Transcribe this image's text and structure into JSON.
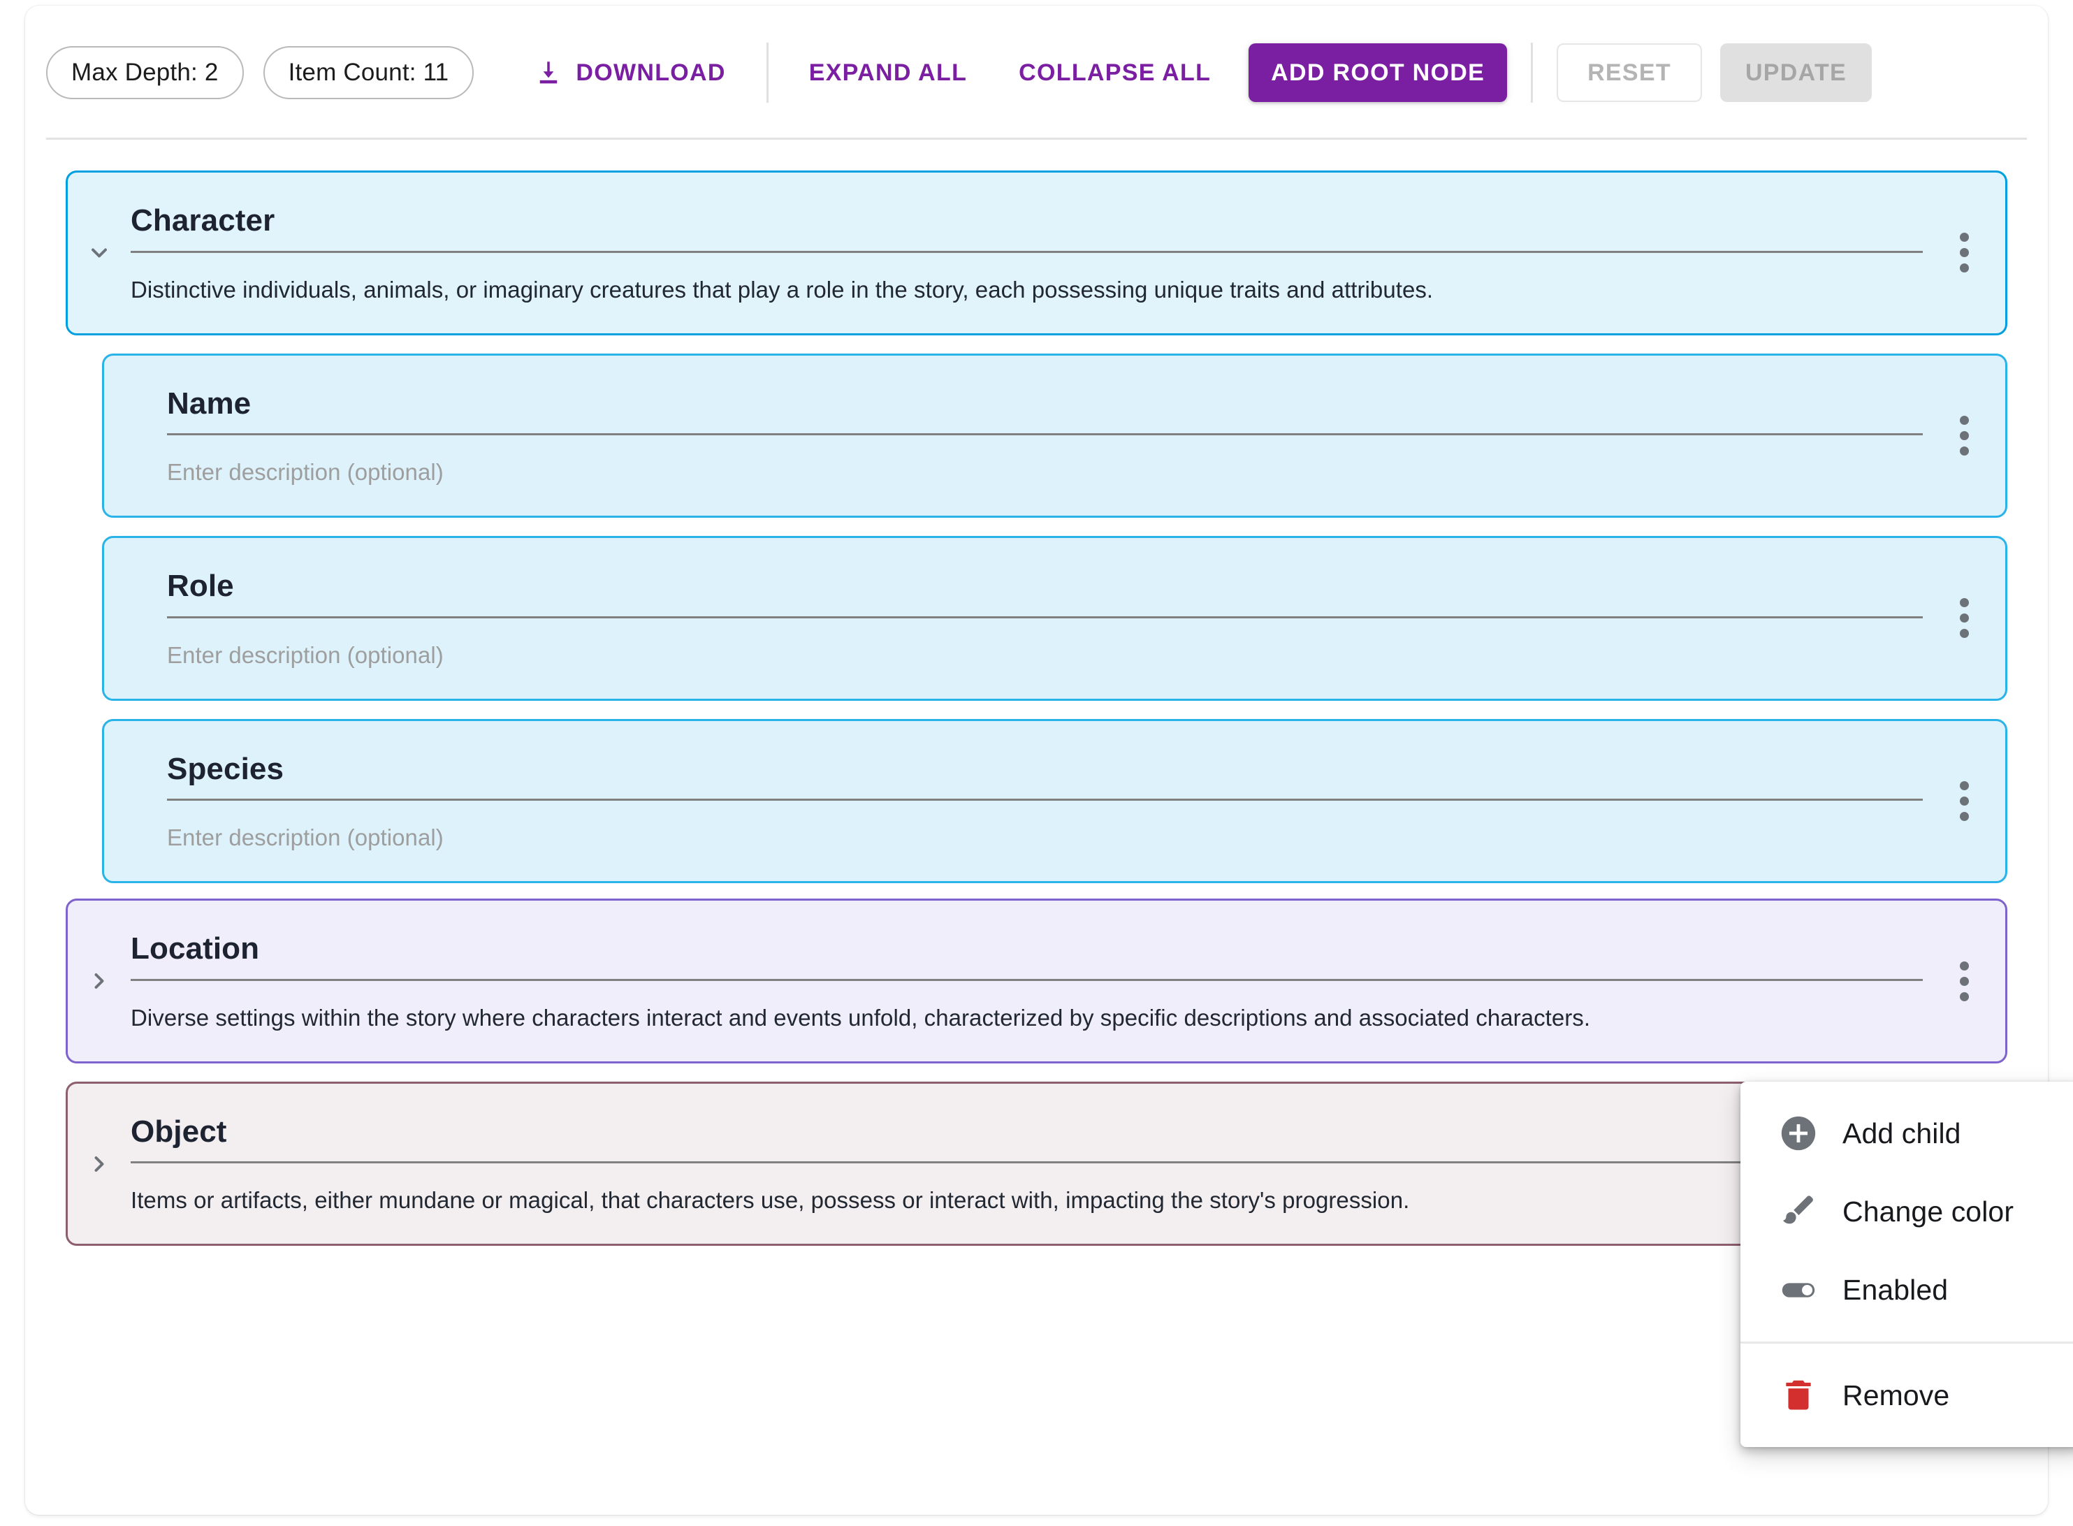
{
  "toolbar": {
    "max_depth_chip": "Max Depth: 2",
    "item_count_chip": "Item Count: 11",
    "download_label": "DOWNLOAD",
    "expand_all_label": "EXPAND ALL",
    "collapse_all_label": "COLLAPSE ALL",
    "add_root_node_label": "ADD ROOT NODE",
    "reset_label": "RESET",
    "update_label": "UPDATE",
    "accent_color": "#7b1fa2",
    "download_icon": "download-icon"
  },
  "tree": {
    "description_placeholder": "Enter description (optional)",
    "nodes": [
      {
        "title": "Character",
        "description": "Distinctive individuals, animals, or imaginary creatures that play a role in the story, each possessing unique traits and attributes.",
        "expanded": true,
        "chevron": "chevron-down-icon",
        "level": "root",
        "border_color": "#00a0e0",
        "fill_color": "#e1f4fc",
        "is_placeholder": false
      },
      {
        "title": "Name",
        "description": "Enter description (optional)",
        "expanded": false,
        "chevron": "none",
        "level": "child",
        "border_color": "#29b3e8",
        "fill_color": "#ddf2fb",
        "is_placeholder": true
      },
      {
        "title": "Role",
        "description": "Enter description (optional)",
        "expanded": false,
        "chevron": "none",
        "level": "child",
        "border_color": "#29b3e8",
        "fill_color": "#ddf2fb",
        "is_placeholder": true
      },
      {
        "title": "Species",
        "description": "Enter description (optional)",
        "expanded": false,
        "chevron": "none",
        "level": "child",
        "border_color": "#29b3e8",
        "fill_color": "#ddf2fb",
        "is_placeholder": true
      },
      {
        "title": "Location",
        "description": "Diverse settings within the story where characters interact and events unfold, characterized by specific descriptions and associated characters.",
        "expanded": false,
        "chevron": "chevron-right-icon",
        "level": "root",
        "border_color": "#7e63cf",
        "fill_color": "#f0eefa",
        "is_placeholder": false
      },
      {
        "title": "Object",
        "description": "Items or artifacts, either mundane or magical, that characters use, possess or interact with, impacting the story's progression.",
        "expanded": false,
        "chevron": "chevron-right-icon",
        "level": "root",
        "border_color": "#8d5f6e",
        "fill_color": "#f3eef0",
        "is_placeholder": false
      }
    ]
  },
  "context_menu": {
    "items": [
      {
        "label": "Add child",
        "icon": "add-circle-icon",
        "color": "#6d7278"
      },
      {
        "label": "Change color",
        "icon": "brush-icon",
        "color": "#6d7278"
      },
      {
        "label": "Enabled",
        "icon": "toggle-on-icon",
        "color": "#6d7278"
      },
      {
        "label": "Remove",
        "icon": "trash-icon",
        "color": "#d32f2f"
      }
    ]
  }
}
